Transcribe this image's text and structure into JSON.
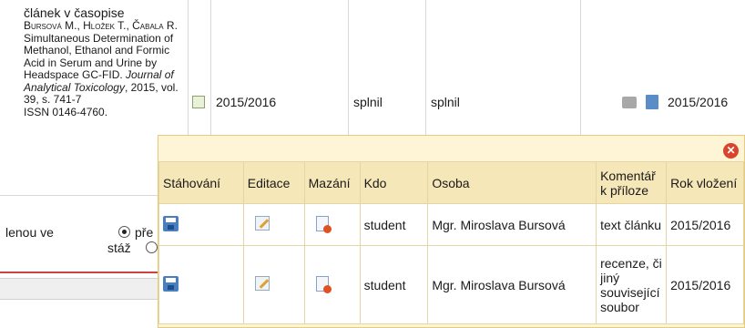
{
  "background_row": {
    "citation_type": "článek v časopise",
    "authors": "Bursová M., Hložek T., Čabala R.",
    "title": "Simultaneous Determination of Methanol, Ethanol and Formic Acid in Serum and Urine by Headspace GC-FID.",
    "journal": "Journal of Analytical Toxicology",
    "details": ", 2015, vol. 39, s. 741-7",
    "issn": "ISSN 0146-4760.",
    "year": "2015/2016",
    "status1": "splnil",
    "status2": "splnil",
    "year_right": "2015/2016"
  },
  "form": {
    "label_left": "lenou ve",
    "radio1_label": "pře",
    "radio2_label": "stáž"
  },
  "popup": {
    "headers": {
      "download": "Stáhování",
      "edit": "Editace",
      "delete": "Mazání",
      "who": "Kdo",
      "person": "Osoba",
      "comment": "Komentář k příloze",
      "year": "Rok vložení"
    },
    "rows": [
      {
        "who": "student",
        "person": "Mgr. Miroslava Bursová",
        "comment": "text článku",
        "year": "2015/2016"
      },
      {
        "who": "student",
        "person": "Mgr. Miroslava Bursová",
        "comment": "recenze, či jiný související soubor",
        "year": "2015/2016"
      }
    ]
  }
}
